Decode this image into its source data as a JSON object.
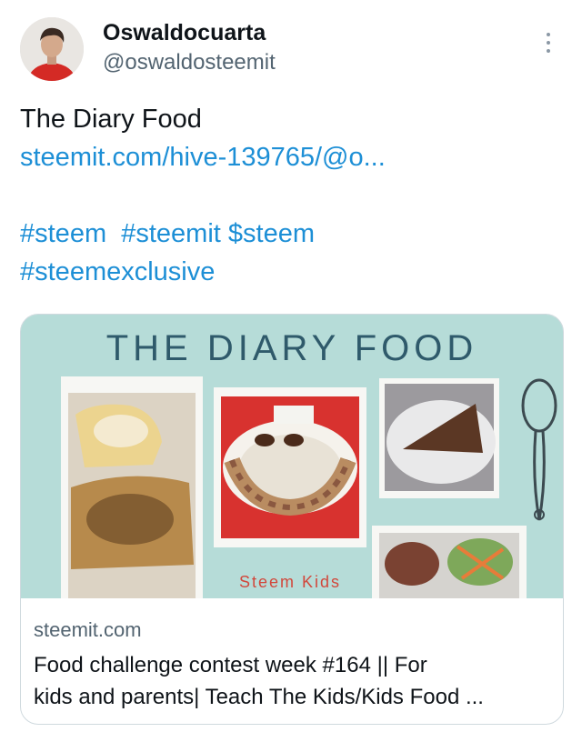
{
  "author": {
    "name": "Oswaldocuarta",
    "handle": "@oswaldosteemit"
  },
  "tweet": {
    "title": "The Diary Food",
    "link": "steemit.com/hive-139765/@o...",
    "tags_line1": [
      "#steem",
      "#steemit",
      "$steem"
    ],
    "tags_line2": "#steemexclusive"
  },
  "card": {
    "image": {
      "heading": "THE DIARY FOOD",
      "caption": "Steem Kids"
    },
    "domain": "steemit.com",
    "title_line1": "Food challenge contest week #164 || For",
    "title_line2": "kids and parents| Teach The Kids/Kids Food ..."
  },
  "icons": {
    "more": "more-vertical-icon"
  },
  "colors": {
    "link": "#1d8fd6",
    "card_bg": "#b6dcd8",
    "heading": "#2f5a6b",
    "caption": "#d2473b"
  }
}
